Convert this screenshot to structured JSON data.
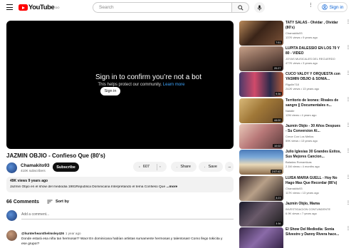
{
  "colors": {
    "brand": "#ff0000",
    "link": "#065fd4",
    "dark": "#0f0f0f",
    "secondary": "#606060"
  },
  "header": {
    "logo_text": "YouTube",
    "logo_country": "DO",
    "search_placeholder": "Search",
    "signin_label": "Sign in"
  },
  "player": {
    "message_title": "Sign in to confirm you’re not a bot",
    "message_text": "This helps protect our community.",
    "learn_more": "Learn more",
    "signin_label": "Sign in"
  },
  "video": {
    "title": "JAZMIN OBJIO - Confieso Que (80's)",
    "channel_name": "Chamakito93",
    "channel_subs": "410K subscribers",
    "subscribe_label": "Subscribe",
    "likes": "607",
    "share_label": "Share",
    "save_label": "Save",
    "more_label": "..."
  },
  "description": {
    "meta": "49K views  9 years ago",
    "text": "Jazmin Objio en el show del mediodia 1981Republica Dominicana Interpretando el tema Confieso Que",
    "more_label": "...more"
  },
  "comments": {
    "count_label": "66 Comments",
    "sort_label": "Sort by",
    "add_placeholder": "Add a comment...",
    "items": [
      {
        "author": "@hunterhearsthelmsley426",
        "time": "1 year ago",
        "text": "Donde estará esa niña tan hermosa!!? Wao! En dominicana habían artistas sumamente hermosas y talentosas! Como llego tokicita y ese grupo!?"
      }
    ]
  },
  "recommendations": [
    {
      "title": "TATY SALAS - Olvidar , Olvidar (80's)",
      "channel": "Chamakito93",
      "meta": "137K views • 9 years ago",
      "duration": "7:51"
    },
    {
      "title": "LUPITA DALESSIO EN LOS 70 Y 80 - VIDEO",
      "channel": "JOYAS MUSICALES DEL RECUERDO",
      "meta": "477K views • 3 years ago",
      "duration": "20:27"
    },
    {
      "title": "CUCO VALOY Y ORQUESTA con YASMIN OBJIO & SONIA...",
      "channel": "Rigolin718",
      "meta": "242K views • 13 years ago",
      "duration": "9:36"
    },
    {
      "title": "Territorio de leones: Rivales de sangre || Documentales n...",
      "channel": "Natalie",
      "meta": "12M views • 4 years ago",
      "duration": "44:00"
    },
    {
      "title": "Jazmin Objio - 30 Años Despues - Su Conversion Al...",
      "channel": "Crece Con Los Mellos",
      "meta": "59K views • 13 years ago",
      "duration": "10:02"
    },
    {
      "title": "Julio Iglesias 30 Grandes Exitos, Sus Mejores Cancion...",
      "channel": "Baladas Romanticas",
      "meta": "2.1M views • 4 months ago",
      "duration": "2:07:42"
    },
    {
      "title": "LUISA MARIA GUELL - Hoy No Hago Mas Que Recordar (80's)",
      "channel": "Chamakito93",
      "meta": "117K views • 13 years ago",
      "duration": "3:23"
    },
    {
      "title": "Jazmin Objio, Mama",
      "channel": "INVESTIGACION CONTUNDENTE",
      "meta": "6.9K views • 7 years ago",
      "duration": "3:36"
    },
    {
      "title": "El Show Del Mediodia: Sonia Silvestre y Danny Rivera hace...",
      "channel": "",
      "meta": "",
      "duration": ""
    }
  ]
}
